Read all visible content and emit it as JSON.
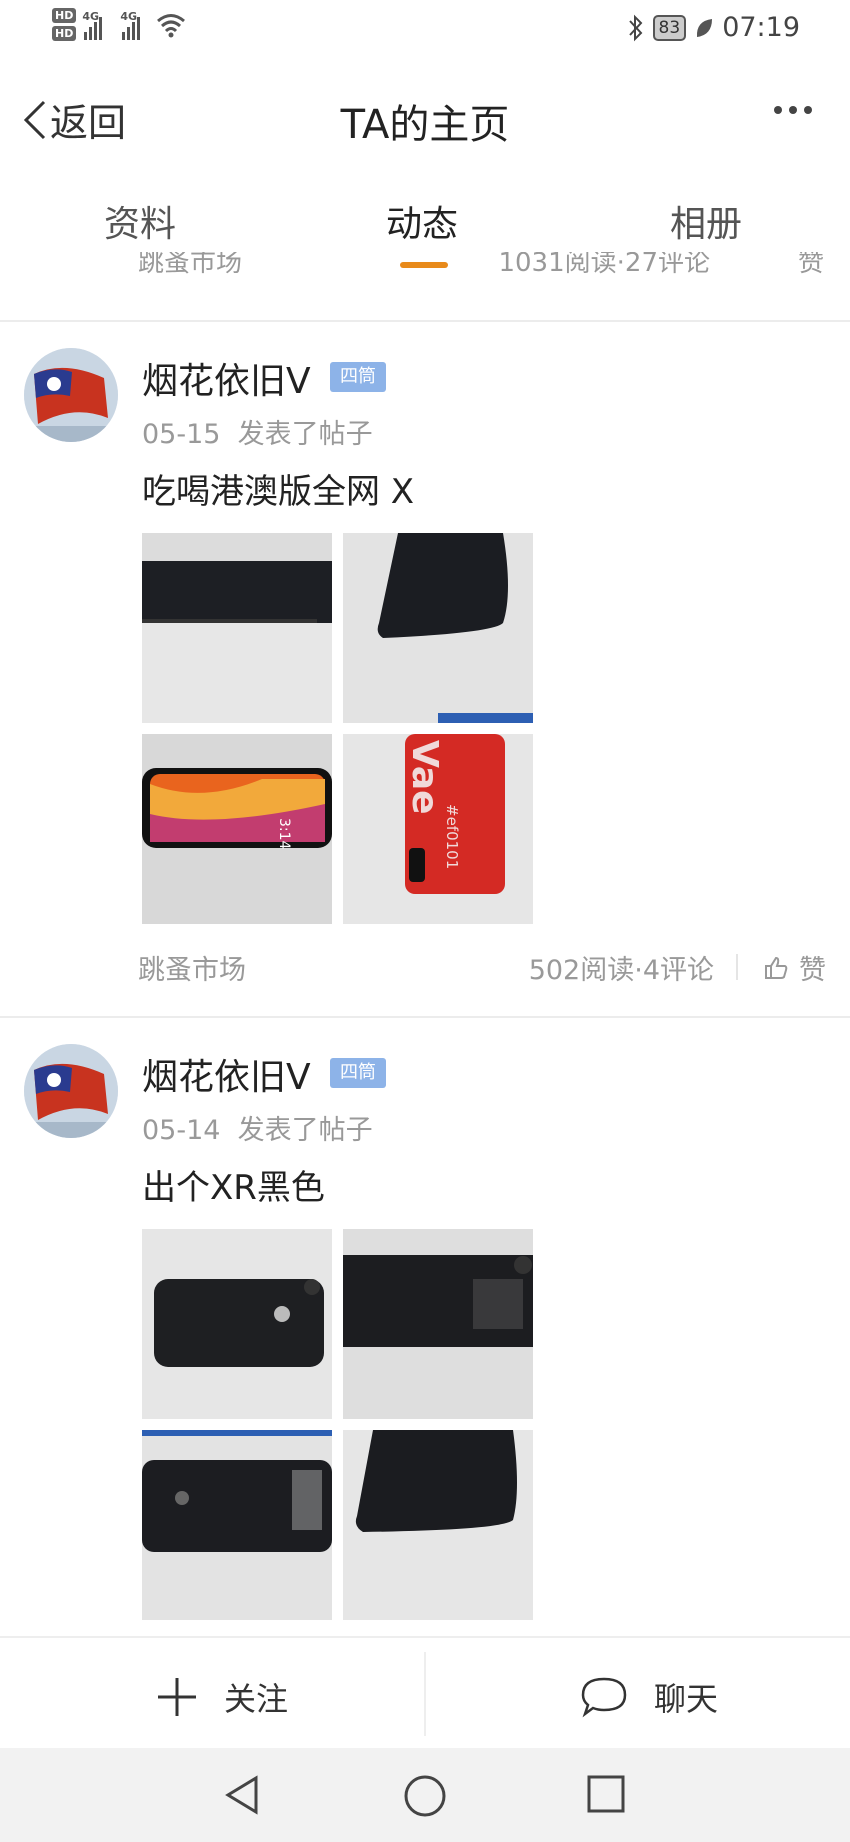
{
  "status_bar": {
    "hd1": "HD",
    "hd2": "HD",
    "net1": "4G",
    "net2": "4G",
    "battery": "83",
    "time": "07:19"
  },
  "header": {
    "back_label": "返回",
    "title": "TA的主页"
  },
  "tabs": [
    {
      "label": "资料"
    },
    {
      "label": "动态",
      "active": true
    },
    {
      "label": "相册"
    }
  ],
  "prev_post_footer": {
    "source": "跳蚤市场",
    "stats": "1031阅读·27评论",
    "like": "赞"
  },
  "posts": [
    {
      "author": "烟花依旧V",
      "badge": "四筒",
      "date": "05-15",
      "action": "发表了帖子",
      "text": "吃喝港澳版全网 X",
      "source": "跳蚤市场",
      "stats": "502阅读·4评论",
      "like": "赞",
      "images": [
        "phone-front-dark",
        "phone-corner-front",
        "phone-screen-orange",
        "phone-red-case-back"
      ],
      "case_text": "Vae",
      "case_sub": "#ef0101",
      "screen_time": "3:14"
    },
    {
      "author": "烟花依旧V",
      "badge": "四筒",
      "date": "05-14",
      "action": "发表了帖子",
      "text": "出个XR黑色",
      "images": [
        "xr-back-black",
        "xr-side",
        "xr-back-apple",
        "xr-bottom-edge"
      ]
    }
  ],
  "action_bar": {
    "follow_label": "关注",
    "chat_label": "聊天"
  },
  "colors": {
    "accent": "#e88a1a",
    "badge": "#8db3e8"
  }
}
